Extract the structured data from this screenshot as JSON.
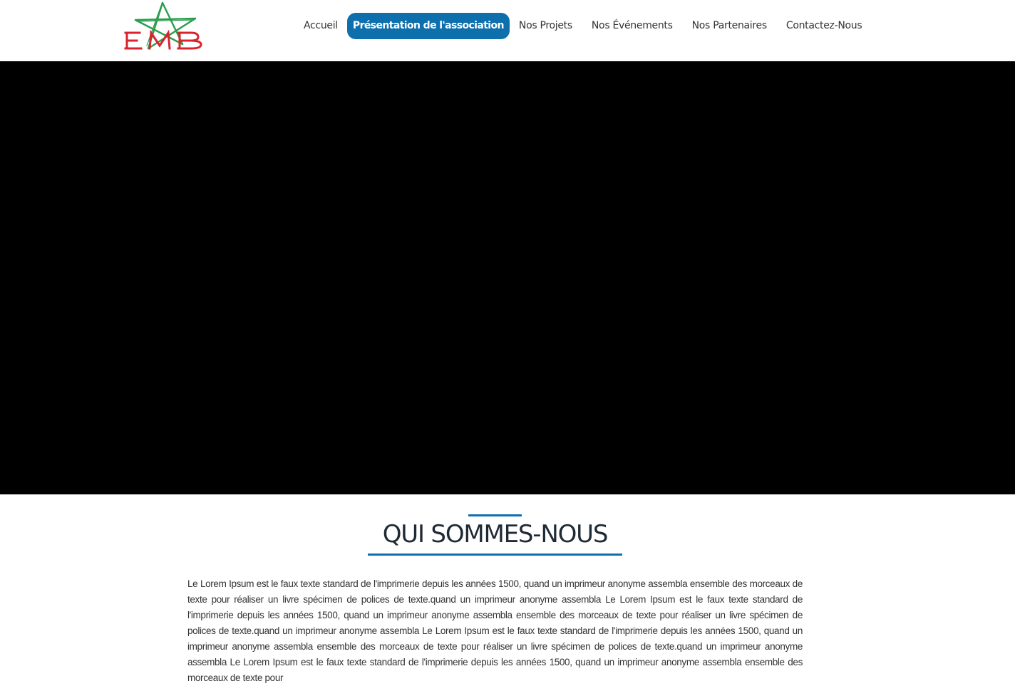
{
  "brand": {
    "logo_text": "EMB",
    "colors": {
      "logo_green": "#2a9d4e",
      "logo_red": "#d9232d",
      "accent_blue": "#0e6fad"
    }
  },
  "nav": {
    "items": [
      {
        "label": "Accueil",
        "active": false
      },
      {
        "label": "Présentation de l'association",
        "active": true
      },
      {
        "label": "Nos Projets",
        "active": false
      },
      {
        "label": "Nos Événements",
        "active": false
      },
      {
        "label": "Nos Partenaires",
        "active": false
      },
      {
        "label": "Contactez-Nous",
        "active": false
      }
    ]
  },
  "hero": {
    "background_color": "#000000"
  },
  "about": {
    "title": "QUI SOMMES-NOUS",
    "paragraph": "Le Lorem Ipsum est le faux texte standard de l'imprimerie depuis les années 1500, quand un imprimeur anonyme assembla ensemble des morceaux de texte pour réaliser un livre spécimen de polices de texte.quand un imprimeur anonyme assembla Le Lorem Ipsum est le faux texte standard de l'imprimerie depuis les années 1500, quand un imprimeur anonyme assembla ensemble des morceaux de texte pour réaliser un livre spécimen de polices de texte.quand un imprimeur anonyme assembla Le Lorem Ipsum est le faux texte standard de l'imprimerie depuis les années 1500, quand un imprimeur anonyme assembla ensemble des morceaux de texte pour réaliser un livre spécimen de polices de texte.quand un imprimeur anonyme assembla Le Lorem Ipsum est le faux texte standard de l'imprimerie depuis les années 1500, quand un imprimeur anonyme assembla ensemble des morceaux de texte pour"
  }
}
